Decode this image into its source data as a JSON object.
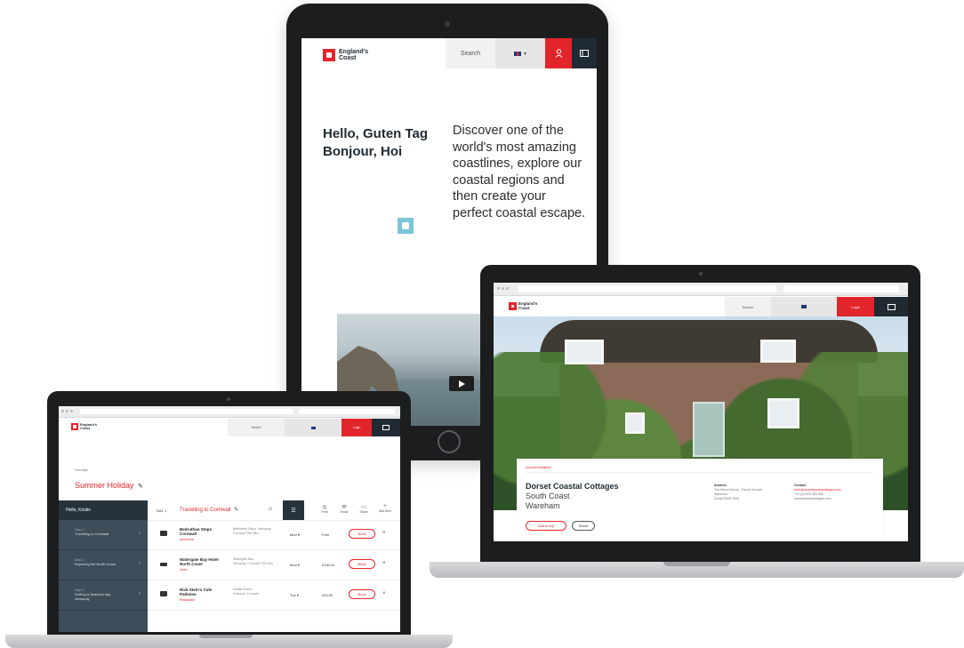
{
  "brand": {
    "line1": "England's",
    "line2": "Coast",
    "color": "#e2252b",
    "dark": "#1f2a33"
  },
  "tablet": {
    "nav_search": "Search",
    "nav_lang_icon": "uk-flag-icon",
    "nav_user_icon": "user-icon",
    "nav_menu_icon": "panel-icon",
    "hero_title": "Hello, Guten Tag Bonjour, Hoi",
    "hero_body": "Discover one of the world's most amazing coastlines, explore our coastal regions and then create your perfect coastal escape.",
    "video_play_icon": "play-icon"
  },
  "right_laptop": {
    "nav_search": "Search",
    "nav_cta": "Login",
    "card_eyebrow": "Accommodation",
    "title": "Dorset Coastal Cottages",
    "subtitle1": "South Coast",
    "subtitle2": "Wareham",
    "col1_head": "Address",
    "col1_lines": [
      "The Manor House, Church Knowle",
      "Wareham",
      "Dorset BH20 5NQ"
    ],
    "col2_head": "Contact",
    "col2_lines": [
      "hello@dorsetcoastalcottages.com",
      "+44 (0)1929 480 888",
      "dorsetcoastalcottages.com"
    ],
    "btn_primary": "Add to trip",
    "btn_secondary": "Share"
  },
  "left_laptop": {
    "nav_search": "Search",
    "nav_cta": "Login",
    "eyebrow": "Your trips",
    "trip_title": "Summer Holiday",
    "sidebar_head": "Hello, Kristin",
    "day_label": "DAY 1",
    "day_title": "Travelling to Cornwall",
    "toolbar": [
      "Print",
      "Email",
      "Share",
      "Add item"
    ],
    "sidebar_items": [
      {
        "day": "Day 1",
        "label": "Travelling to Cornwall"
      },
      {
        "day": "Day 2",
        "label": "Exploring the North Coast"
      },
      {
        "day": "Day 3",
        "label": "Surfing & beaches day",
        "label2": "Newquay"
      }
    ],
    "rows": [
      {
        "title": "Bedruthan Steps",
        "title2": "Cornwall",
        "sub": "Adventure",
        "desc": "Bedruthan Steps, Newquay,",
        "desc2": "Cornwall TR8 4BU",
        "date": "Mon ▾",
        "price": "Free",
        "btn": "Book"
      },
      {
        "title": "Watergate Bay Hotel",
        "title2": "North Coast",
        "sub": "Hotel",
        "desc": "Watergate Bay,",
        "desc2": "Newquay, Cornwall TR8 4AA",
        "date": "Mon ▾",
        "price": "£180.00",
        "btn": "Book"
      },
      {
        "title": "Rick Stein's Cafe",
        "title2": "Padstow",
        "sub": "Restaurant",
        "desc": "Middle Street,",
        "desc2": "Padstow, Cornwall",
        "date": "Tue ▾",
        "price": "£45.00",
        "btn": "Book"
      }
    ]
  }
}
